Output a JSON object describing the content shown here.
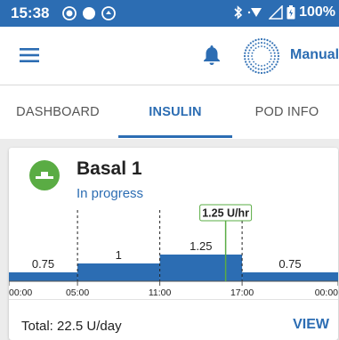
{
  "status_bar": {
    "time": "15:38",
    "battery": "100%",
    "icons": [
      "notification-dot-icon",
      "circle-icon",
      "at-sign-icon",
      "bluetooth-icon",
      "wifi-icon",
      "signal-icon",
      "battery-icon"
    ]
  },
  "app_bar": {
    "mode": "Manual",
    "icons": [
      "menu-icon",
      "bell-icon",
      "pod-icon"
    ]
  },
  "tabs": [
    {
      "label": "DASHBOARD",
      "active": false
    },
    {
      "label": "INSULIN",
      "active": true
    },
    {
      "label": "POD INFO",
      "active": false
    }
  ],
  "basal": {
    "title": "Basal 1",
    "status": "In progress",
    "total": "Total:  22.5 U/day",
    "view_label": "VIEW"
  },
  "chart_data": {
    "type": "area",
    "segments": [
      {
        "start": "00:00",
        "end": "05:00",
        "rate": 0.75,
        "label": "0.75"
      },
      {
        "start": "05:00",
        "end": "11:00",
        "rate": 1,
        "label": "1"
      },
      {
        "start": "11:00",
        "end": "17:00",
        "rate": 1.25,
        "label": "1.25"
      },
      {
        "start": "17:00",
        "end": "24:00",
        "rate": 0.75,
        "label": "0.75"
      }
    ],
    "x_ticks": [
      "00:00",
      "05:00",
      "11:00",
      "17:00",
      "00:00"
    ],
    "current_rate_label": "1.25 U/hr",
    "current_time_hours": 15.8,
    "colors": {
      "bar": "#2c6db3",
      "marker": "#5aac44"
    }
  }
}
